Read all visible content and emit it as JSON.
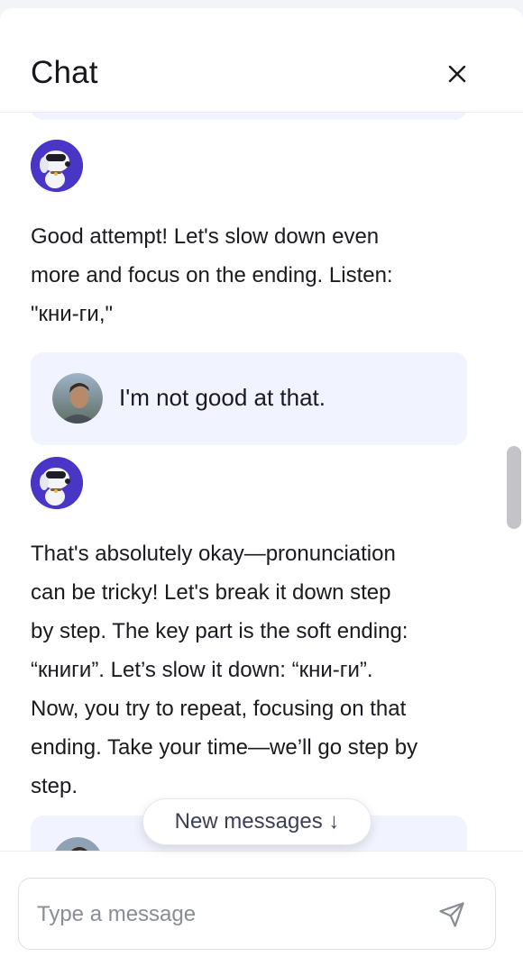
{
  "header": {
    "title": "Chat",
    "close_icon": "close-icon"
  },
  "messages": [
    {
      "role": "assistant",
      "avatar_icon": "robot-dog-avatar",
      "text_lines": [
        "Good attempt! Let's slow down even",
        "more and focus on the ending. Listen:",
        "\"кни-ги,\""
      ]
    },
    {
      "role": "user",
      "avatar_icon": "user-photo-avatar",
      "text": "I'm not good at that."
    },
    {
      "role": "assistant",
      "avatar_icon": "robot-dog-avatar",
      "text_lines": [
        "That's absolutely okay—pronunciation",
        "can be tricky! Let's break it down step",
        "by step. The key part is the soft ending:",
        "“книги”. Let’s slow it down: “кни-ги”.",
        "Now, you try to repeat, focusing on that",
        "ending. Take your time—we’ll go step by",
        "step."
      ]
    }
  ],
  "new_messages_pill": {
    "label": "New messages ↓"
  },
  "composer": {
    "placeholder": "Type a message",
    "value": "",
    "send_icon": "send-icon"
  },
  "colors": {
    "accent_avatar_bg": "#4a36c6",
    "bubble_bg": "#f1f3fe",
    "border": "#e0e0e6"
  }
}
